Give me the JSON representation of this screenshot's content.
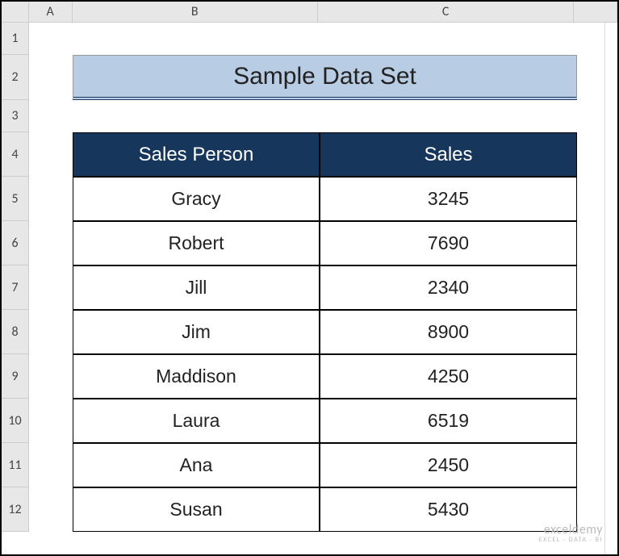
{
  "columns": {
    "a": "A",
    "b": "B",
    "c": "C"
  },
  "rows": [
    "1",
    "2",
    "3",
    "4",
    "5",
    "6",
    "7",
    "8",
    "9",
    "10",
    "11",
    "12"
  ],
  "title": "Sample Data Set",
  "headers": {
    "person": "Sales Person",
    "sales": "Sales"
  },
  "data": [
    {
      "person": "Gracy",
      "sales": "3245"
    },
    {
      "person": "Robert",
      "sales": "7690"
    },
    {
      "person": "Jill",
      "sales": "2340"
    },
    {
      "person": "Jim",
      "sales": "8900"
    },
    {
      "person": "Maddison",
      "sales": "4250"
    },
    {
      "person": "Laura",
      "sales": "6519"
    },
    {
      "person": "Ana",
      "sales": "2450"
    },
    {
      "person": "Susan",
      "sales": "5430"
    }
  ],
  "watermark": {
    "top": "exceldemy",
    "bottom": "EXCEL · DATA · BI"
  },
  "chart_data": {
    "type": "table",
    "title": "Sample Data Set",
    "columns": [
      "Sales Person",
      "Sales"
    ],
    "rows": [
      [
        "Gracy",
        3245
      ],
      [
        "Robert",
        7690
      ],
      [
        "Jill",
        2340
      ],
      [
        "Jim",
        8900
      ],
      [
        "Maddison",
        4250
      ],
      [
        "Laura",
        6519
      ],
      [
        "Ana",
        2450
      ],
      [
        "Susan",
        5430
      ]
    ]
  }
}
